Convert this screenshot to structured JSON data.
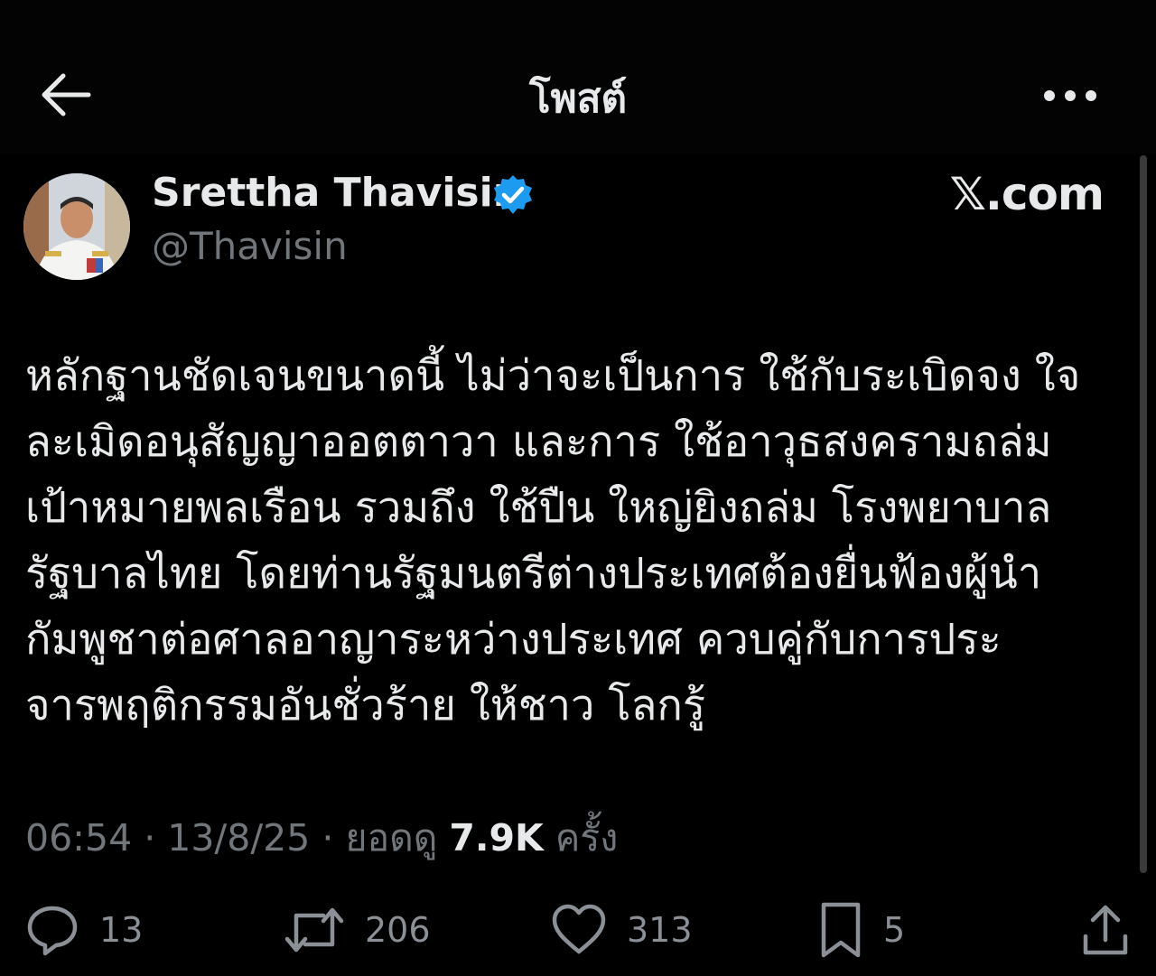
{
  "header": {
    "title": "โพสต์",
    "back_icon": "arrow-left-icon",
    "more_icon": "more-horizontal-icon"
  },
  "author": {
    "name": "Srettha Thavisin",
    "handle": "@Thavisin",
    "verified": true,
    "verified_color": "#1d9bf0"
  },
  "watermark": "𝕏.com",
  "tweet": {
    "lines": [
      "หลักฐานชัดเจนขนาดนี้ ไม่ว่าจะเป็นการ ใช้กับระเบิดจง ใจ",
      "ละเมิดอนุสัญญาออตตาวา และการ ใช้อาวุธสงครามถล่ม",
      "เป้าหมายพลเรือน รวมถึง ใช้ปืน ใหญ่ยิงถล่ม โรงพยาบาล",
      "รัฐบาลไทย โดยท่านรัฐมนตรีต่างประเทศต้องยื่นฟ้องผู้นำ",
      "กัมพูชาต่อศาลอาญาระหว่างประเทศ ควบคู่กับการประ",
      "จารพฤติกรรมอันชั่วร้าย ให้ชาว โลกรู้"
    ]
  },
  "meta": {
    "time": "06:54",
    "separator": " · ",
    "date": "13/8/25",
    "views_label": "ยอดดู",
    "views_count": "7.9K",
    "views_suffix": "ครั้ง"
  },
  "actions": {
    "reply": {
      "icon": "reply-icon",
      "count": "13"
    },
    "repost": {
      "icon": "repost-icon",
      "count": "206"
    },
    "like": {
      "icon": "heart-icon",
      "count": "313"
    },
    "bookmark": {
      "icon": "bookmark-icon",
      "count": "5"
    },
    "share": {
      "icon": "share-icon"
    }
  },
  "colors": {
    "background": "#000000",
    "text": "#e7e9ea",
    "muted": "#71767b",
    "accent": "#1d9bf0"
  }
}
